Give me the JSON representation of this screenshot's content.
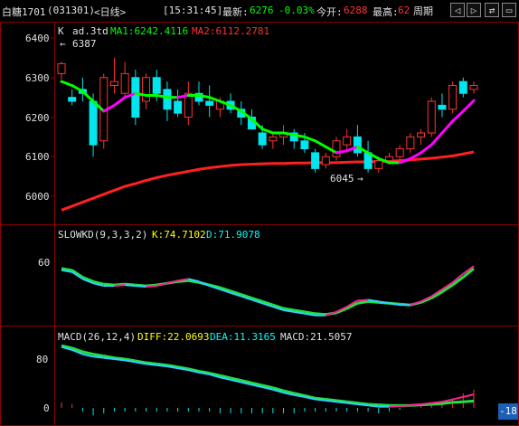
{
  "header": {
    "symbol": "白糖1701",
    "code": "(031301)",
    "period": "<日线>",
    "time": "[15:31:45]",
    "latest_label": "最新:",
    "latest": "6276",
    "change": "-0.03%",
    "open_label": "今开:",
    "open": "6288",
    "high_label": "最高:",
    "high": "62",
    "period_btn": "周期",
    "nav_left": "◁",
    "nav_right": "▷",
    "nav_swap": "⇄",
    "nav_max": "▭"
  },
  "kpanel": {
    "k_label": "K",
    "indicator": "ad.3td",
    "ma1_label": "MA1:6242.4116",
    "ma2_label": "MA2:6112.2781",
    "y_ticks": [
      "6400",
      "6300",
      "6200",
      "6100",
      "6000"
    ],
    "high_marker": "6387",
    "low_marker": "6045"
  },
  "kdpanel": {
    "title": "SLOWKD(9,3,3,2)",
    "k_label": "K:74.7102",
    "d_label": "D:71.9078",
    "y_ticks": [
      "60"
    ]
  },
  "macdpanel": {
    "title": "MACD(26,12,4)",
    "diff_label": "DIFF:22.0693",
    "dea_label": "DEA:11.3165",
    "macd_label": "MACD:21.5057",
    "y_ticks": [
      "80",
      "0"
    ],
    "badge": "-18"
  },
  "colors": {
    "up": "#ff3232",
    "down": "#00e5ee",
    "ma1": "#00ff00",
    "ma1_alt": "#ff00ff",
    "ma2": "#ff2020",
    "k_line": "#e040e0",
    "d_line": "#30e0e0",
    "text_yellow": "#ffff00",
    "text_green": "#00ff00",
    "text_cyan": "#00ffff"
  },
  "candles": [
    {
      "o": 6310,
      "h": 6340,
      "l": 6295,
      "c": 6335
    },
    {
      "o": 6250,
      "h": 6270,
      "l": 6230,
      "c": 6240
    },
    {
      "o": 6270,
      "h": 6300,
      "l": 6240,
      "c": 6260
    },
    {
      "o": 6240,
      "h": 6260,
      "l": 6100,
      "c": 6130
    },
    {
      "o": 6140,
      "h": 6310,
      "l": 6120,
      "c": 6300
    },
    {
      "o": 6280,
      "h": 6350,
      "l": 6260,
      "c": 6290
    },
    {
      "o": 6260,
      "h": 6340,
      "l": 6250,
      "c": 6310
    },
    {
      "o": 6300,
      "h": 6320,
      "l": 6180,
      "c": 6200
    },
    {
      "o": 6240,
      "h": 6310,
      "l": 6220,
      "c": 6300
    },
    {
      "o": 6300,
      "h": 6320,
      "l": 6240,
      "c": 6260
    },
    {
      "o": 6270,
      "h": 6290,
      "l": 6190,
      "c": 6220
    },
    {
      "o": 6240,
      "h": 6270,
      "l": 6200,
      "c": 6210
    },
    {
      "o": 6200,
      "h": 6290,
      "l": 6180,
      "c": 6260
    },
    {
      "o": 6260,
      "h": 6290,
      "l": 6230,
      "c": 6240
    },
    {
      "o": 6240,
      "h": 6280,
      "l": 6200,
      "c": 6230
    },
    {
      "o": 6220,
      "h": 6250,
      "l": 6200,
      "c": 6240
    },
    {
      "o": 6240,
      "h": 6260,
      "l": 6210,
      "c": 6220
    },
    {
      "o": 6220,
      "h": 6240,
      "l": 6180,
      "c": 6200
    },
    {
      "o": 6200,
      "h": 6220,
      "l": 6170,
      "c": 6170
    },
    {
      "o": 6160,
      "h": 6180,
      "l": 6120,
      "c": 6130
    },
    {
      "o": 6140,
      "h": 6160,
      "l": 6120,
      "c": 6150
    },
    {
      "o": 6150,
      "h": 6180,
      "l": 6130,
      "c": 6160
    },
    {
      "o": 6160,
      "h": 6170,
      "l": 6120,
      "c": 6140
    },
    {
      "o": 6140,
      "h": 6160,
      "l": 6110,
      "c": 6120
    },
    {
      "o": 6110,
      "h": 6120,
      "l": 6060,
      "c": 6070
    },
    {
      "o": 6080,
      "h": 6110,
      "l": 6070,
      "c": 6100
    },
    {
      "o": 6100,
      "h": 6150,
      "l": 6090,
      "c": 6140
    },
    {
      "o": 6130,
      "h": 6170,
      "l": 6110,
      "c": 6150
    },
    {
      "o": 6150,
      "h": 6180,
      "l": 6100,
      "c": 6110
    },
    {
      "o": 6110,
      "h": 6140,
      "l": 6060,
      "c": 6070
    },
    {
      "o": 6070,
      "h": 6100,
      "l": 6060,
      "c": 6090
    },
    {
      "o": 6090,
      "h": 6110,
      "l": 6080,
      "c": 6100
    },
    {
      "o": 6100,
      "h": 6130,
      "l": 6090,
      "c": 6120
    },
    {
      "o": 6120,
      "h": 6160,
      "l": 6110,
      "c": 6150
    },
    {
      "o": 6150,
      "h": 6170,
      "l": 6130,
      "c": 6160
    },
    {
      "o": 6160,
      "h": 6250,
      "l": 6150,
      "c": 6240
    },
    {
      "o": 6230,
      "h": 6260,
      "l": 6200,
      "c": 6220
    },
    {
      "o": 6220,
      "h": 6290,
      "l": 6210,
      "c": 6280
    },
    {
      "o": 6290,
      "h": 6300,
      "l": 6250,
      "c": 6260
    },
    {
      "o": 6270,
      "h": 6290,
      "l": 6260,
      "c": 6280
    }
  ],
  "ma1": [
    6290,
    6280,
    6265,
    6240,
    6215,
    6230,
    6250,
    6260,
    6255,
    6255,
    6250,
    6250,
    6255,
    6255,
    6250,
    6240,
    6230,
    6215,
    6195,
    6170,
    6160,
    6160,
    6155,
    6150,
    6140,
    6125,
    6110,
    6115,
    6125,
    6110,
    6095,
    6085,
    6085,
    6095,
    6110,
    6130,
    6160,
    6190,
    6215,
    6242
  ],
  "ma2": [
    5965,
    5975,
    5985,
    5995,
    6005,
    6015,
    6025,
    6032,
    6040,
    6047,
    6053,
    6058,
    6063,
    6068,
    6072,
    6075,
    6078,
    6080,
    6081,
    6082,
    6083,
    6083,
    6084,
    6084,
    6085,
    6085,
    6085,
    6086,
    6087,
    6087,
    6088,
    6089,
    6090,
    6092,
    6094,
    6096,
    6099,
    6102,
    6107,
    6112
  ],
  "kd_k": [
    70,
    68,
    60,
    55,
    52,
    52,
    53,
    52,
    51,
    52,
    55,
    58,
    60,
    57,
    52,
    48,
    44,
    40,
    36,
    32,
    28,
    24,
    22,
    20,
    18,
    18,
    22,
    28,
    35,
    36,
    34,
    32,
    30,
    30,
    34,
    40,
    48,
    56,
    66,
    74.7
  ],
  "kd_d": [
    72,
    70,
    62,
    57,
    54,
    53,
    54,
    53,
    52,
    53,
    55,
    57,
    58,
    56,
    53,
    50,
    46,
    42,
    38,
    34,
    30,
    26,
    24,
    22,
    20,
    19,
    21,
    26,
    32,
    34,
    33,
    32,
    31,
    30,
    33,
    38,
    45,
    53,
    62,
    71.9
  ],
  "diff": [
    100,
    95,
    88,
    84,
    82,
    80,
    78,
    75,
    72,
    70,
    68,
    65,
    62,
    58,
    55,
    50,
    46,
    42,
    38,
    34,
    30,
    25,
    21,
    18,
    14,
    12,
    10,
    8,
    6,
    4,
    2,
    2,
    3,
    4,
    6,
    8,
    10,
    14,
    18,
    22
  ],
  "dea": [
    102,
    98,
    92,
    88,
    85,
    82,
    80,
    77,
    74,
    72,
    70,
    67,
    64,
    60,
    57,
    53,
    49,
    45,
    41,
    37,
    33,
    28,
    24,
    20,
    16,
    14,
    12,
    10,
    8,
    6,
    5,
    4,
    4,
    4,
    5,
    6,
    7,
    9,
    10,
    11.3
  ],
  "hist": [
    3,
    2,
    -2,
    -4,
    -3,
    -2,
    -2,
    -2,
    -2,
    -2,
    -2,
    -2,
    -2,
    -2,
    -2,
    -3,
    -3,
    -3,
    -3,
    -3,
    -3,
    -3,
    -3,
    -2,
    -2,
    -2,
    -2,
    -2,
    -2,
    -2,
    -3,
    -2,
    -1,
    0,
    1,
    2,
    3,
    5,
    8,
    10
  ]
}
